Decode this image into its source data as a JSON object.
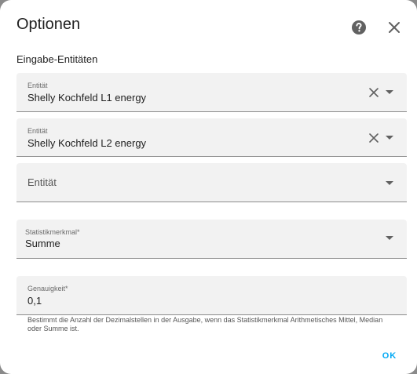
{
  "dialog": {
    "title": "Optionen",
    "help_icon": "help-circle-icon",
    "close_icon": "close-icon"
  },
  "section": {
    "label": "Eingabe-Entitäten"
  },
  "entities": [
    {
      "label": "Entität",
      "value": "Shelly Kochfeld L1 energy"
    },
    {
      "label": "Entität",
      "value": "Shelly Kochfeld L2 energy"
    },
    {
      "label": "Entität",
      "value": ""
    }
  ],
  "statistic": {
    "label": "Statistikmerkmal*",
    "value": "Summe"
  },
  "precision": {
    "label": "Genauigkeit*",
    "value": "0,1",
    "helper": "Bestimmt die Anzahl der Dezimalstellen in der Ausgabe, wenn das Statistikmerkmal Arithmetisches Mittel, Median oder Summe ist."
  },
  "actions": {
    "ok_label": "OK"
  },
  "colors": {
    "accent": "#03a9f4",
    "field_bg": "#f2f2f2",
    "icon": "#616161"
  }
}
